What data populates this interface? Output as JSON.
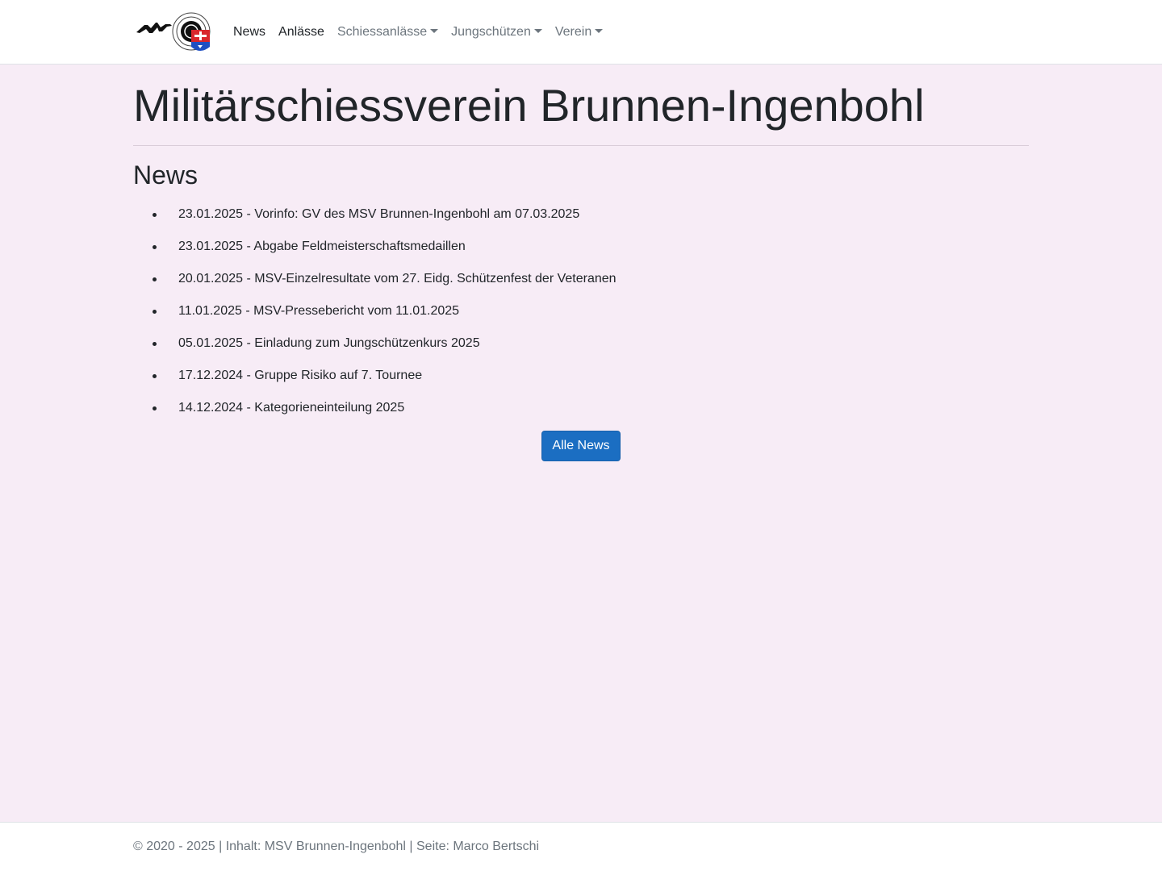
{
  "nav": {
    "logo_icon": "msv-target-logo-icon",
    "items": [
      {
        "label": "News",
        "dropdown": false,
        "style": "active"
      },
      {
        "label": "Anlässe",
        "dropdown": false,
        "style": "active"
      },
      {
        "label": "Schiessanlässe",
        "dropdown": true,
        "style": "muted"
      },
      {
        "label": "Jungschützen",
        "dropdown": true,
        "style": "muted"
      },
      {
        "label": "Verein",
        "dropdown": true,
        "style": "muted"
      }
    ]
  },
  "main": {
    "title": "Militärschiessverein Brunnen-Ingenbohl",
    "section_title": "News",
    "news": [
      "23.01.2025 - Vorinfo: GV des MSV Brunnen-Ingenbohl am 07.03.2025",
      "23.01.2025 - Abgabe Feldmeisterschaftsmedaillen",
      "20.01.2025 - MSV-Einzelresultate vom 27. Eidg. Schützenfest der Veteranen",
      "11.01.2025 - MSV-Pressebericht vom 11.01.2025",
      "05.01.2025 - Einladung zum Jungschützenkurs 2025",
      "17.12.2024 - Gruppe Risiko auf 7. Tournee",
      "14.12.2024 - Kategorieneinteilung 2025"
    ],
    "all_news_button": "Alle News"
  },
  "footer": {
    "text": "© 2020 - 2025 | Inhalt: MSV Brunnen-Ingenbohl | Seite: Marco Bertschi"
  },
  "colors": {
    "page_background": "#f7ecf6",
    "primary_button": "#1b6ec2",
    "text": "#212529",
    "muted_text": "#6c757d"
  }
}
